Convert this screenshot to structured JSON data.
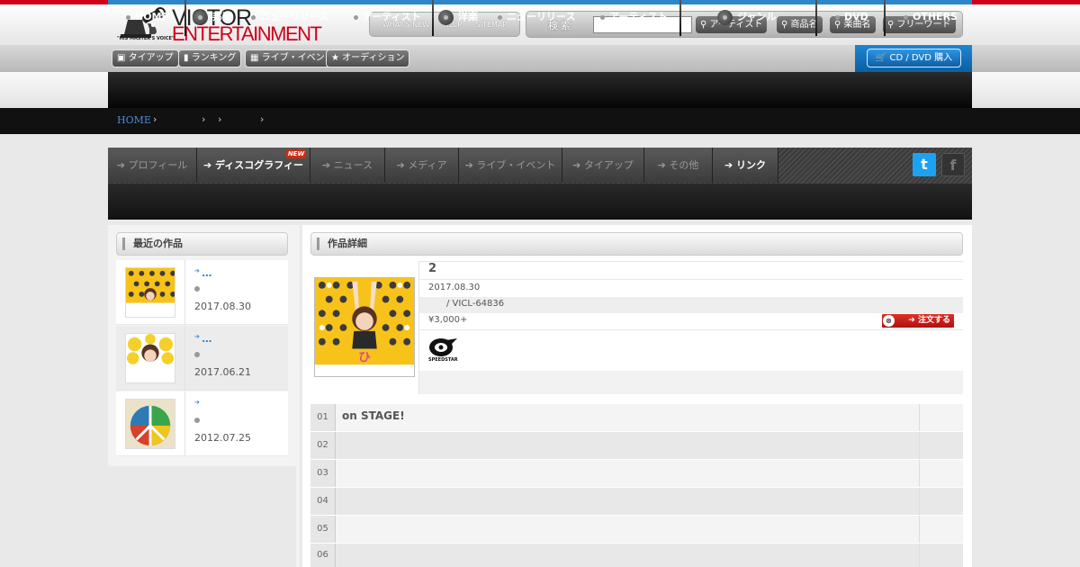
{
  "header": {
    "logo_top": "VICTOR",
    "logo_bottom": "ENTERTAINMENT",
    "logo_sub": "\"HIS MASTER'S VOICE\"",
    "links": [
      "WHAT'S NEW",
      "HELP",
      "SITEMAP"
    ],
    "search_label": "検索",
    "search_placeholder": "",
    "search_buttons": [
      "アーティスト",
      "商品名",
      "楽曲名",
      "フリーワード"
    ]
  },
  "subnav": {
    "items": [
      "タイアップ",
      "ランキング",
      "ライブ・イベント",
      "オーディション"
    ],
    "cd_button": "CD / DVD 購入"
  },
  "mainnav": {
    "items": [
      "HOME",
      "邦楽",
      "ニューリリース",
      "アーティスト",
      "洋楽",
      "ニューリリース",
      "アーティスト",
      "ジャンル",
      "DVD",
      "OTHERS"
    ]
  },
  "breadcrumb": {
    "home": "HOME"
  },
  "artist_tabs": {
    "items": [
      "プロフィール",
      "ディスコグラフィー",
      "ニュース",
      "メディア",
      "ライブ・イベント",
      "タイアップ",
      "その他",
      "リンク"
    ],
    "new_badge": "NEW",
    "active_index": 1
  },
  "recent": {
    "title": "最近の作品",
    "items": [
      {
        "title": "…",
        "date": "2017.08.30"
      },
      {
        "title": "…",
        "date": "2017.06.21"
      },
      {
        "title": "",
        "date": "2012.07.25"
      }
    ]
  },
  "detail": {
    "heading": "作品詳細",
    "title": "2",
    "date": "2017.08.30",
    "code": "/ VICL-64836",
    "price": "¥3,000+",
    "order_label": "注文する",
    "label_logo": "SPEEDSTAR"
  },
  "tracks": [
    {
      "num": "01",
      "name": "on STAGE!"
    },
    {
      "num": "02",
      "name": ""
    },
    {
      "num": "03",
      "name": ""
    },
    {
      "num": "04",
      "name": ""
    },
    {
      "num": "05",
      "name": ""
    },
    {
      "num": "06",
      "name": ""
    }
  ],
  "colors": {
    "accent_red": "#d0001a",
    "accent_blue": "#2d86c8",
    "link_blue": "#2a7fd0",
    "nav_black": "#111111"
  }
}
